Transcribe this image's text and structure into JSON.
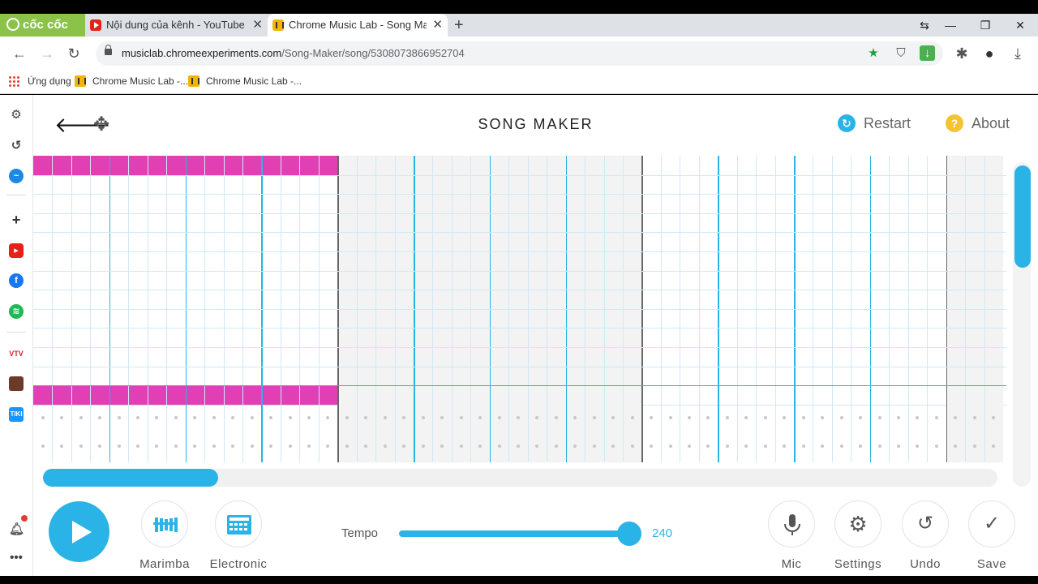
{
  "browser": {
    "brand": "cốc cốc",
    "tabs": [
      {
        "label": "Nội dung của kênh - YouTube"
      },
      {
        "label": "Chrome Music Lab - Song Maker"
      }
    ],
    "url_host": "musiclab.chromeexperiments.com",
    "url_path": "/Song-Maker/song/5308073866952704",
    "bookmarks": [
      "Ứng dụng",
      "Chrome Music Lab -...",
      "Chrome Music Lab -..."
    ]
  },
  "app": {
    "title": "SONG MAKER",
    "restart_label": "Restart",
    "about_label": "About",
    "instrument_label": "Marimba",
    "percussion_label": "Electronic",
    "tempo_label": "Tempo",
    "tempo_value": "240",
    "tempo_fraction": 1.0,
    "mic_label": "Mic",
    "settings_label": "Settings",
    "undo_label": "Undo",
    "save_label": "Save",
    "note_color": "#e040b4",
    "accent_color": "#2ab3e6",
    "highlighted_notes": [
      {
        "row": 0,
        "from_col": 0,
        "to_col": 15
      },
      {
        "row": 12,
        "from_col": 0,
        "to_col": 15
      }
    ],
    "grid": {
      "columns": 51,
      "melody_rows": 13,
      "rhythm_rows": 2
    }
  }
}
